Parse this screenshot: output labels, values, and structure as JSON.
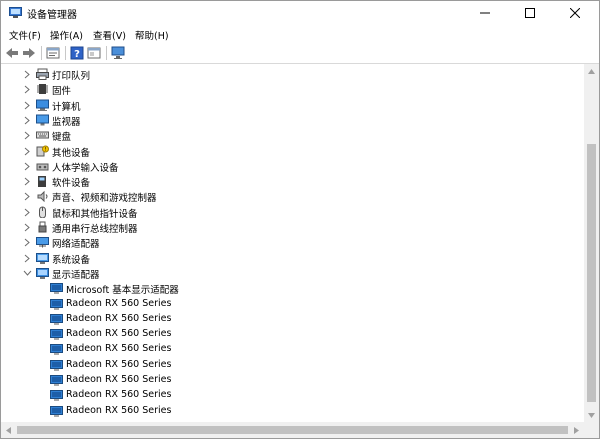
{
  "window": {
    "title": "设备管理器"
  },
  "menu": [
    "文件(F)",
    "操作(A)",
    "查看(V)",
    "帮助(H)"
  ],
  "tree": {
    "categories": [
      {
        "label": "打印队列",
        "icon": "printer-icon"
      },
      {
        "label": "固件",
        "icon": "firmware-icon"
      },
      {
        "label": "计算机",
        "icon": "computer-icon"
      },
      {
        "label": "监视器",
        "icon": "monitor-icon"
      },
      {
        "label": "键盘",
        "icon": "keyboard-icon"
      },
      {
        "label": "其他设备",
        "icon": "other-device-icon"
      },
      {
        "label": "人体学输入设备",
        "icon": "hid-icon"
      },
      {
        "label": "软件设备",
        "icon": "software-device-icon"
      },
      {
        "label": "声音、视频和游戏控制器",
        "icon": "speaker-icon"
      },
      {
        "label": "鼠标和其他指针设备",
        "icon": "mouse-icon"
      },
      {
        "label": "通用串行总线控制器",
        "icon": "usb-icon"
      },
      {
        "label": "网络适配器",
        "icon": "network-adapter-icon"
      },
      {
        "label": "系统设备",
        "icon": "system-device-icon"
      }
    ],
    "expanded": {
      "label": "显示适配器",
      "icon": "display-adapter-icon"
    },
    "adapters": [
      "Microsoft 基本显示适配器",
      "Radeon RX 560 Series",
      "Radeon RX 560 Series",
      "Radeon RX 560 Series",
      "Radeon RX 560 Series",
      "Radeon RX 560 Series",
      "Radeon RX 560 Series",
      "Radeon RX 560 Series",
      "Radeon RX 560 Series"
    ]
  }
}
